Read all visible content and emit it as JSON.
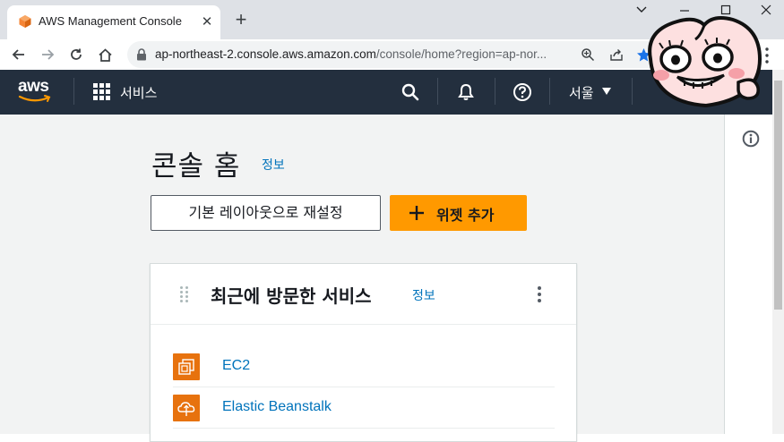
{
  "browser": {
    "tab_title": "AWS Management Console",
    "url_main": "ap-northeast-2.console.aws.amazon.com",
    "url_rest": "/console/home?region=ap-nor..."
  },
  "awsnav": {
    "logo_text": "aws",
    "services_label": "서비스",
    "region_label": "서울"
  },
  "page": {
    "title": "콘솔 홈",
    "info_link": "정보",
    "reset_layout_button": "기본 레이아웃으로 재설정",
    "add_widget_button": "위젯 추가"
  },
  "recent_services": {
    "title": "최근에 방문한 서비스",
    "info_link": "정보",
    "items": [
      {
        "name": "EC2",
        "icon": "ec2-icon"
      },
      {
        "name": "Elastic Beanstalk",
        "icon": "elastic-beanstalk-icon"
      }
    ]
  },
  "colors": {
    "aws_nav_bg": "#232f3e",
    "primary_button": "#ff9900",
    "link": "#0073bb",
    "service_icon": "#e7720e",
    "page_bg": "#f2f3f3"
  }
}
